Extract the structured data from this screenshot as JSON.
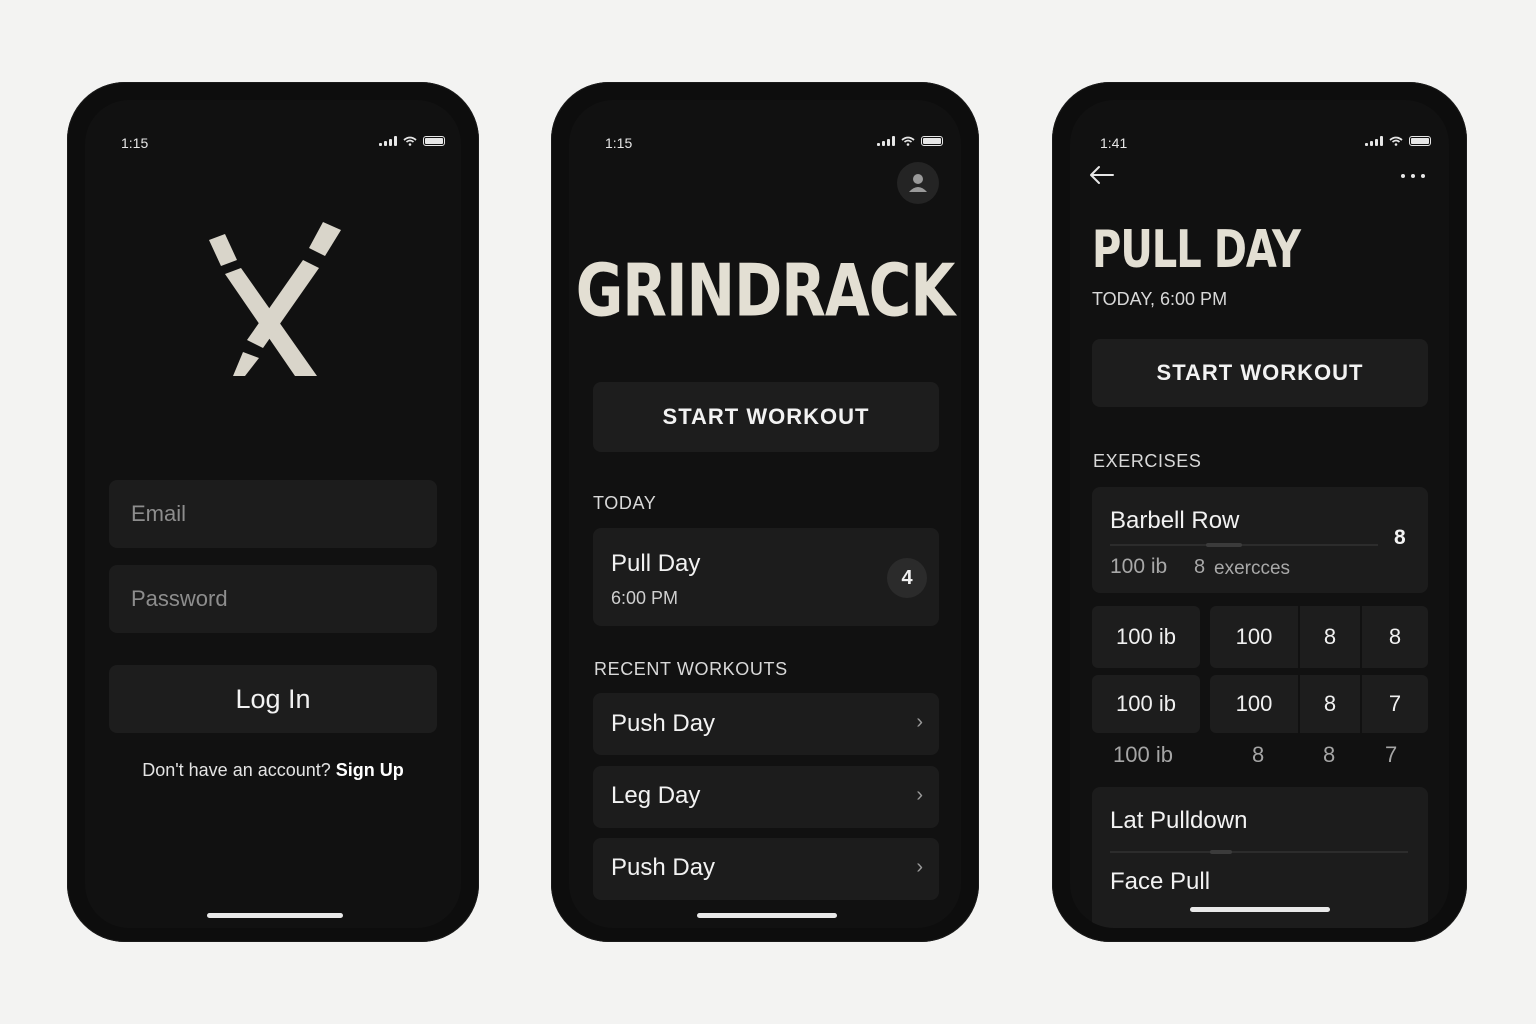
{
  "login": {
    "time": "1:15",
    "email_placeholder": "Email",
    "password_placeholder": "Password",
    "login_label": "Log In",
    "signup_prompt": "Don't have an account?",
    "signup_link": "Sign Up"
  },
  "home": {
    "time": "1:15",
    "app_title": "GRINDRACK",
    "start_label": "START WORKOUT",
    "today_heading": "TODAY",
    "today_card": {
      "title": "Pull Day",
      "time": "6:00 PM",
      "count": "4"
    },
    "recent_heading": "RECENT WORKOUTS",
    "recent": [
      "Push Day",
      "Leg Day",
      "Push Day"
    ]
  },
  "detail": {
    "time": "1:41",
    "title": "PULL DAY",
    "subtitle": "TODAY, 6:00 PM",
    "start_label": "START WORKOUT",
    "exercises_heading": "EXERCISES",
    "exercise1": {
      "name": "Barbell Row",
      "weight": "100 ib",
      "sets": "8",
      "sets_label": "exercces",
      "count": "8"
    },
    "sets_rows": [
      {
        "weight": "100 ib",
        "a": "100",
        "b": "8",
        "c": "8"
      },
      {
        "weight": "100 ib",
        "a": "100",
        "b": "8",
        "c": "7"
      },
      {
        "weight": "100 ib",
        "a": "8",
        "b": "8",
        "c": "7"
      }
    ],
    "exercise2": "Lat Pulldown",
    "exercise3": "Face Pull"
  }
}
